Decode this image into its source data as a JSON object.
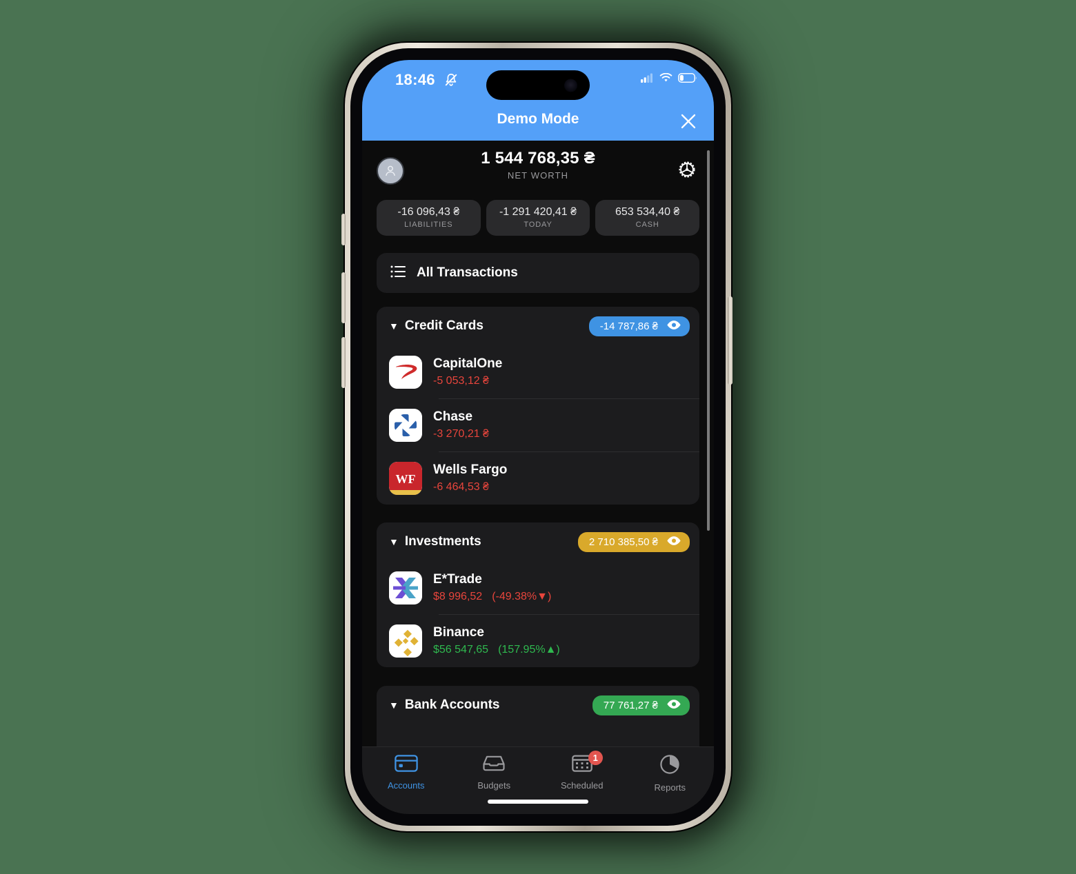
{
  "status_bar": {
    "time": "18:46",
    "mute_icon": "bell-slash-icon",
    "cellular_icon": "cellular-bars-icon",
    "wifi_icon": "wifi-icon",
    "battery_icon": "battery-low-icon",
    "battery_level_percent": 22
  },
  "demo_banner": {
    "title": "Demo Mode",
    "close_icon": "close-icon",
    "accent_color": "#54a0f8"
  },
  "net_worth": {
    "avatar_icon": "person-avatar-icon",
    "value": "1 544 768,35 ₴",
    "label": "NET WORTH",
    "settings_icon": "gear-icon"
  },
  "stats": [
    {
      "value": "-16 096,43 ₴",
      "label": "LIABILITIES"
    },
    {
      "value": "-1 291 420,41 ₴",
      "label": "TODAY"
    },
    {
      "value": "653 534,40 ₴",
      "label": "CASH"
    }
  ],
  "all_transactions": {
    "label": "All Transactions",
    "icon": "list-icon"
  },
  "groups": [
    {
      "title": "Credit Cards",
      "caret": "▼",
      "total": "-14 787,86 ₴",
      "badge_color": "#3f93e3",
      "eye_icon": "eye-icon",
      "accounts": [
        {
          "name": "CapitalOne",
          "amount": "-5 053,12 ₴",
          "amount_tone": "neg",
          "change": "",
          "icon": "capitalone-logo-icon"
        },
        {
          "name": "Chase",
          "amount": "-3 270,21 ₴",
          "amount_tone": "neg",
          "change": "",
          "icon": "chase-logo-icon"
        },
        {
          "name": "Wells Fargo",
          "amount": "-6 464,53 ₴",
          "amount_tone": "neg",
          "change": "",
          "icon": "wellsfargo-logo-icon"
        }
      ]
    },
    {
      "title": "Investments",
      "caret": "▼",
      "total": "2 710 385,50 ₴",
      "badge_color": "#d9a92b",
      "eye_icon": "eye-icon",
      "accounts": [
        {
          "name": "E*Trade",
          "amount": "$8 996,52",
          "amount_tone": "neg",
          "change": "(-49.38%▼)",
          "change_tone": "neg",
          "icon": "etrade-logo-icon"
        },
        {
          "name": "Binance",
          "amount": "$56 547,65",
          "amount_tone": "pos",
          "change": "(157.95%▲)",
          "change_tone": "pos",
          "icon": "binance-logo-icon"
        }
      ]
    },
    {
      "title": "Bank Accounts",
      "caret": "▼",
      "total": "77 761,27 ₴",
      "badge_color": "#34a853",
      "eye_icon": "eye-icon",
      "accounts": []
    }
  ],
  "tab_bar": [
    {
      "label": "Accounts",
      "icon": "credit-card-icon",
      "active": true,
      "badge": ""
    },
    {
      "label": "Budgets",
      "icon": "tray-icon",
      "active": false,
      "badge": ""
    },
    {
      "label": "Scheduled",
      "icon": "calendar-icon",
      "active": false,
      "badge": "1"
    },
    {
      "label": "Reports",
      "icon": "pie-chart-icon",
      "active": false,
      "badge": ""
    }
  ],
  "colors": {
    "page_background": "#4a7352",
    "accent_blue": "#3f93e3",
    "gold": "#d9a92b",
    "green": "#34a853",
    "negative_red": "#e8453c",
    "positive_green": "#2fb94f"
  }
}
